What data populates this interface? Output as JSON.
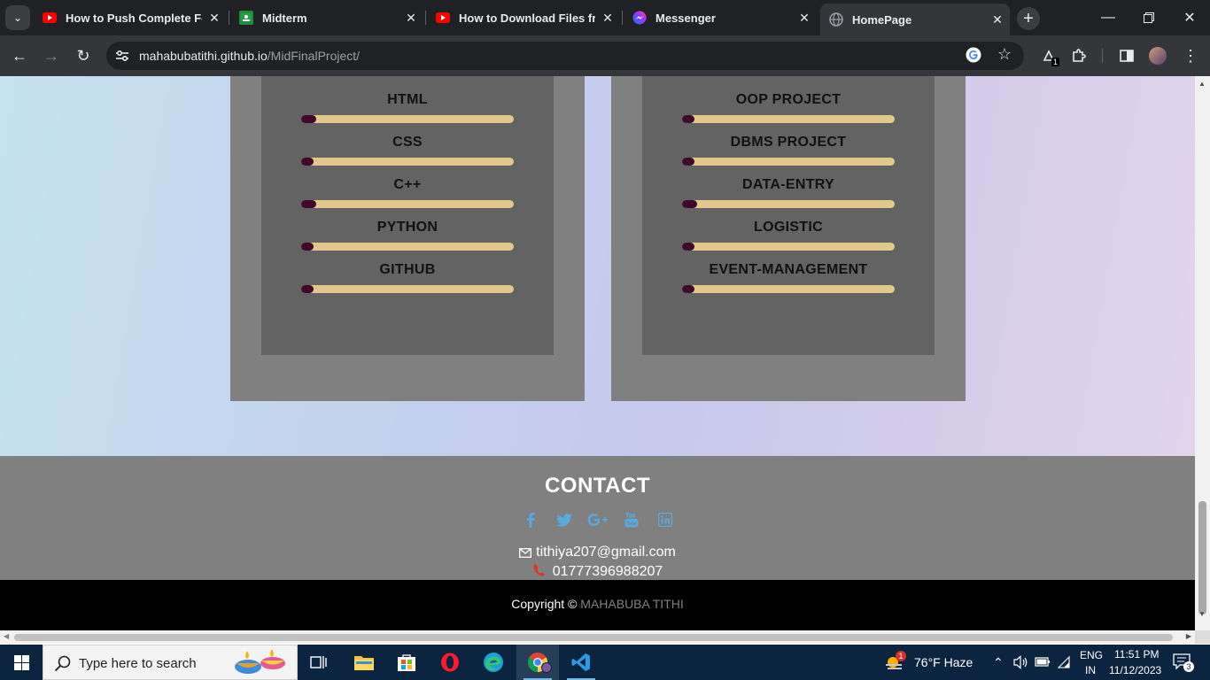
{
  "browser": {
    "tabs": [
      {
        "title": "How to Push Complete Folder",
        "favicon": "youtube-icon"
      },
      {
        "title": "Midterm",
        "favicon": "google-classroom-icon"
      },
      {
        "title": "How to Download Files from",
        "favicon": "youtube-icon"
      },
      {
        "title": "Messenger",
        "favicon": "messenger-icon"
      },
      {
        "title": "HomePage",
        "favicon": "globe-icon",
        "active": true
      }
    ],
    "url_host": "mahabubatithi.github.io",
    "url_path": "/MidFinalProject/",
    "extension_badge": "1"
  },
  "skills": {
    "left": [
      {
        "label": "HTML",
        "level": 0.07
      },
      {
        "label": "CSS",
        "level": 0.06
      },
      {
        "label": "C++",
        "level": 0.07
      },
      {
        "label": "PYTHON",
        "level": 0.06
      },
      {
        "label": "GITHUB",
        "level": 0.06
      }
    ],
    "right": [
      {
        "label": "OOP PROJECT",
        "level": 0.06
      },
      {
        "label": "DBMS PROJECT",
        "level": 0.06
      },
      {
        "label": "DATA-ENTRY",
        "level": 0.07
      },
      {
        "label": "LOGISTIC",
        "level": 0.05
      },
      {
        "label": "EVENT-MANAGEMENT",
        "level": 0.06
      }
    ]
  },
  "contact": {
    "title": "CONTACT",
    "social_icons": [
      "facebook-icon",
      "twitter-icon",
      "google-plus-icon",
      "youtube-icon",
      "linkedin-icon"
    ],
    "email": "tithiya207@gmail.com",
    "phone": "01777396988207"
  },
  "footer": {
    "copyright_prefix": "Copyright ©",
    "name": "MAHABUBA TITHI"
  },
  "taskbar": {
    "search_placeholder": "Type here to search",
    "weather": "76°F  Haze",
    "weather_badge": "1",
    "lang_top": "ENG",
    "lang_bottom": "IN",
    "time": "11:51 PM",
    "date": "11/12/2023",
    "notifications": "3"
  },
  "colors": {
    "bar_track": "#e0c98a",
    "bar_fill": "#3d0a2c",
    "social": "#5aa9dc"
  }
}
